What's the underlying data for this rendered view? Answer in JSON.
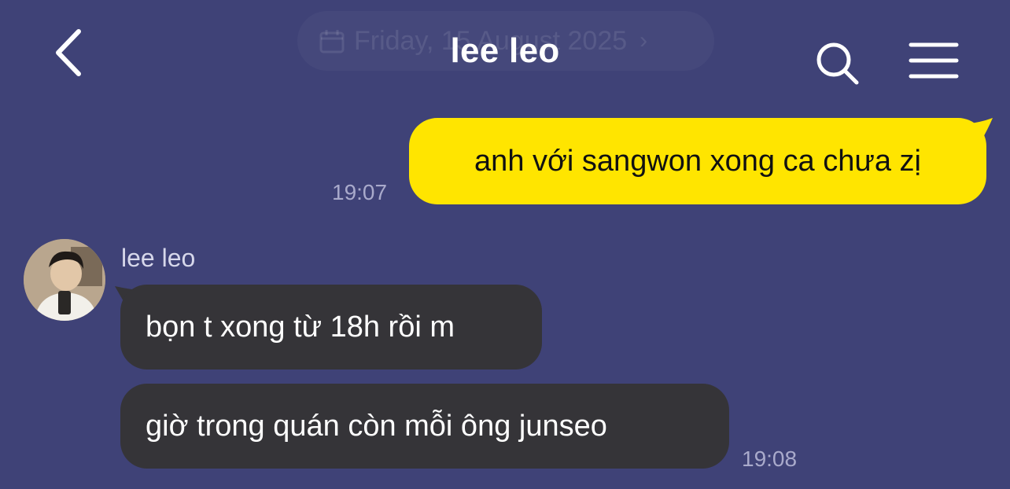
{
  "header": {
    "title": "lee leo",
    "date_label": "Friday, 15 August 2025",
    "icons": {
      "back": "chevron-left-icon",
      "calendar": "calendar-icon",
      "date_chevron": "chevron-right-icon",
      "search": "search-icon",
      "menu": "hamburger-menu-icon"
    }
  },
  "messages": [
    {
      "direction": "outgoing",
      "text": "anh với sangwon xong ca chưa zị",
      "time": "19:07"
    },
    {
      "direction": "incoming",
      "sender": "lee leo",
      "text": "bọn t xong từ 18h rồi m"
    },
    {
      "direction": "incoming",
      "text": "giờ trong quán còn mỗi ông junseo",
      "time": "19:08"
    }
  ],
  "colors": {
    "background": "#3f4277",
    "outgoing_bubble": "#ffe500",
    "incoming_bubble": "#353438",
    "timestamp": "#a9aacb"
  }
}
